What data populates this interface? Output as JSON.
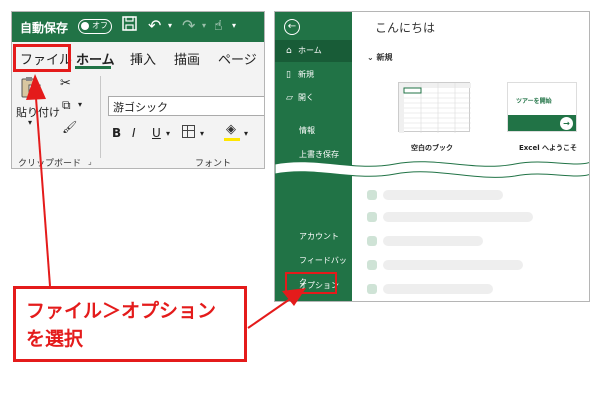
{
  "ribbon": {
    "autosave_label": "自動保存",
    "toggle_text": "オフ",
    "tabs": {
      "file": "ファイル",
      "home": "ホーム",
      "insert": "挿入",
      "draw": "描画",
      "page": "ページ"
    },
    "paste_label": "貼り付け",
    "clipboard_group": "クリップボード",
    "font_name": "游ゴシック",
    "bold": "B",
    "italic": "I",
    "underline": "U",
    "font_group": "フォント"
  },
  "backstage": {
    "greeting": "こんにちは",
    "nav": {
      "home": "ホーム",
      "new": "新規",
      "open": "開く",
      "info": "情報",
      "save": "上書き保存",
      "account": "アカウント",
      "feedback": "フィードバック",
      "options": "オプション"
    },
    "new_header": "新規",
    "blank_workbook": "空白のブック",
    "tour_thumb_text": "ツアーを開始",
    "tour_label": "Excel へようこそ"
  },
  "callout": {
    "line1": "ファイル＞オプション",
    "line2": "を選択"
  },
  "colors": {
    "excel_green": "#217346",
    "highlight_red": "#e41b1b"
  },
  "icons": [
    "save-icon",
    "undo-icon",
    "redo-icon",
    "touch-mode-icon",
    "back-arrow-icon",
    "home-icon",
    "new-document-icon",
    "open-folder-icon",
    "scissors-icon",
    "copy-icon",
    "format-painter-icon",
    "paste-icon",
    "fill-color-icon",
    "borders-icon"
  ]
}
